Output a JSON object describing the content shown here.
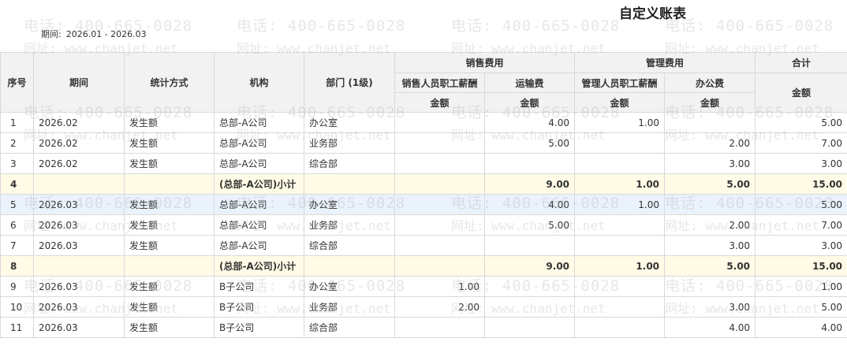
{
  "report": {
    "title": "自定义账表",
    "period_label": "期间:",
    "period_value": "2026.01 - 2026.03"
  },
  "watermark": {
    "phone": "电话: 400-665-0028",
    "site": "网址: www.chanjet.net"
  },
  "table": {
    "headers": {
      "seq": "序号",
      "period": "期间",
      "method": "统计方式",
      "org": "机构",
      "dept": "部门 (1级)",
      "group_sales": "销售费用",
      "group_admin": "管理费用",
      "group_total": "合计",
      "sales_salary": "销售人员职工薪酬",
      "freight": "运输费",
      "admin_salary": "管理人员职工薪酬",
      "office": "办公费",
      "amount": "金额"
    },
    "rows": [
      {
        "seq": "1",
        "period": "2026.02",
        "method": "发生额",
        "org": "总部-A公司",
        "dept": "办公室",
        "sales_salary": "",
        "freight": "4.00",
        "admin_salary": "1.00",
        "office": "",
        "total": "5.00",
        "type": "normal"
      },
      {
        "seq": "2",
        "period": "2026.02",
        "method": "发生额",
        "org": "总部-A公司",
        "dept": "业务部",
        "sales_salary": "",
        "freight": "5.00",
        "admin_salary": "",
        "office": "2.00",
        "total": "7.00",
        "type": "normal"
      },
      {
        "seq": "3",
        "period": "2026.02",
        "method": "发生额",
        "org": "总部-A公司",
        "dept": "综合部",
        "sales_salary": "",
        "freight": "",
        "admin_salary": "",
        "office": "3.00",
        "total": "3.00",
        "type": "normal"
      },
      {
        "seq": "4",
        "period": "",
        "method": "",
        "org": "(总部-A公司)小计",
        "dept": "",
        "sales_salary": "",
        "freight": "9.00",
        "admin_salary": "1.00",
        "office": "5.00",
        "total": "15.00",
        "type": "subtotal"
      },
      {
        "seq": "5",
        "period": "2026.03",
        "method": "发生额",
        "org": "总部-A公司",
        "dept": "办公室",
        "sales_salary": "",
        "freight": "4.00",
        "admin_salary": "1.00",
        "office": "",
        "total": "5.00",
        "type": "selected"
      },
      {
        "seq": "6",
        "period": "2026.03",
        "method": "发生额",
        "org": "总部-A公司",
        "dept": "业务部",
        "sales_salary": "",
        "freight": "5.00",
        "admin_salary": "",
        "office": "2.00",
        "total": "7.00",
        "type": "normal"
      },
      {
        "seq": "7",
        "period": "2026.03",
        "method": "发生额",
        "org": "总部-A公司",
        "dept": "综合部",
        "sales_salary": "",
        "freight": "",
        "admin_salary": "",
        "office": "3.00",
        "total": "3.00",
        "type": "normal"
      },
      {
        "seq": "8",
        "period": "",
        "method": "",
        "org": "(总部-A公司)小计",
        "dept": "",
        "sales_salary": "",
        "freight": "9.00",
        "admin_salary": "1.00",
        "office": "5.00",
        "total": "15.00",
        "type": "subtotal"
      },
      {
        "seq": "9",
        "period": "2026.03",
        "method": "发生额",
        "org": "B子公司",
        "dept": "办公室",
        "sales_salary": "1.00",
        "freight": "",
        "admin_salary": "",
        "office": "",
        "total": "1.00",
        "type": "normal"
      },
      {
        "seq": "10",
        "period": "2026.03",
        "method": "发生额",
        "org": "B子公司",
        "dept": "业务部",
        "sales_salary": "2.00",
        "freight": "",
        "admin_salary": "",
        "office": "3.00",
        "total": "5.00",
        "type": "normal"
      },
      {
        "seq": "11",
        "period": "2026.03",
        "method": "发生额",
        "org": "B子公司",
        "dept": "综合部",
        "sales_salary": "",
        "freight": "",
        "admin_salary": "",
        "office": "4.00",
        "total": "4.00",
        "type": "normal"
      }
    ]
  }
}
